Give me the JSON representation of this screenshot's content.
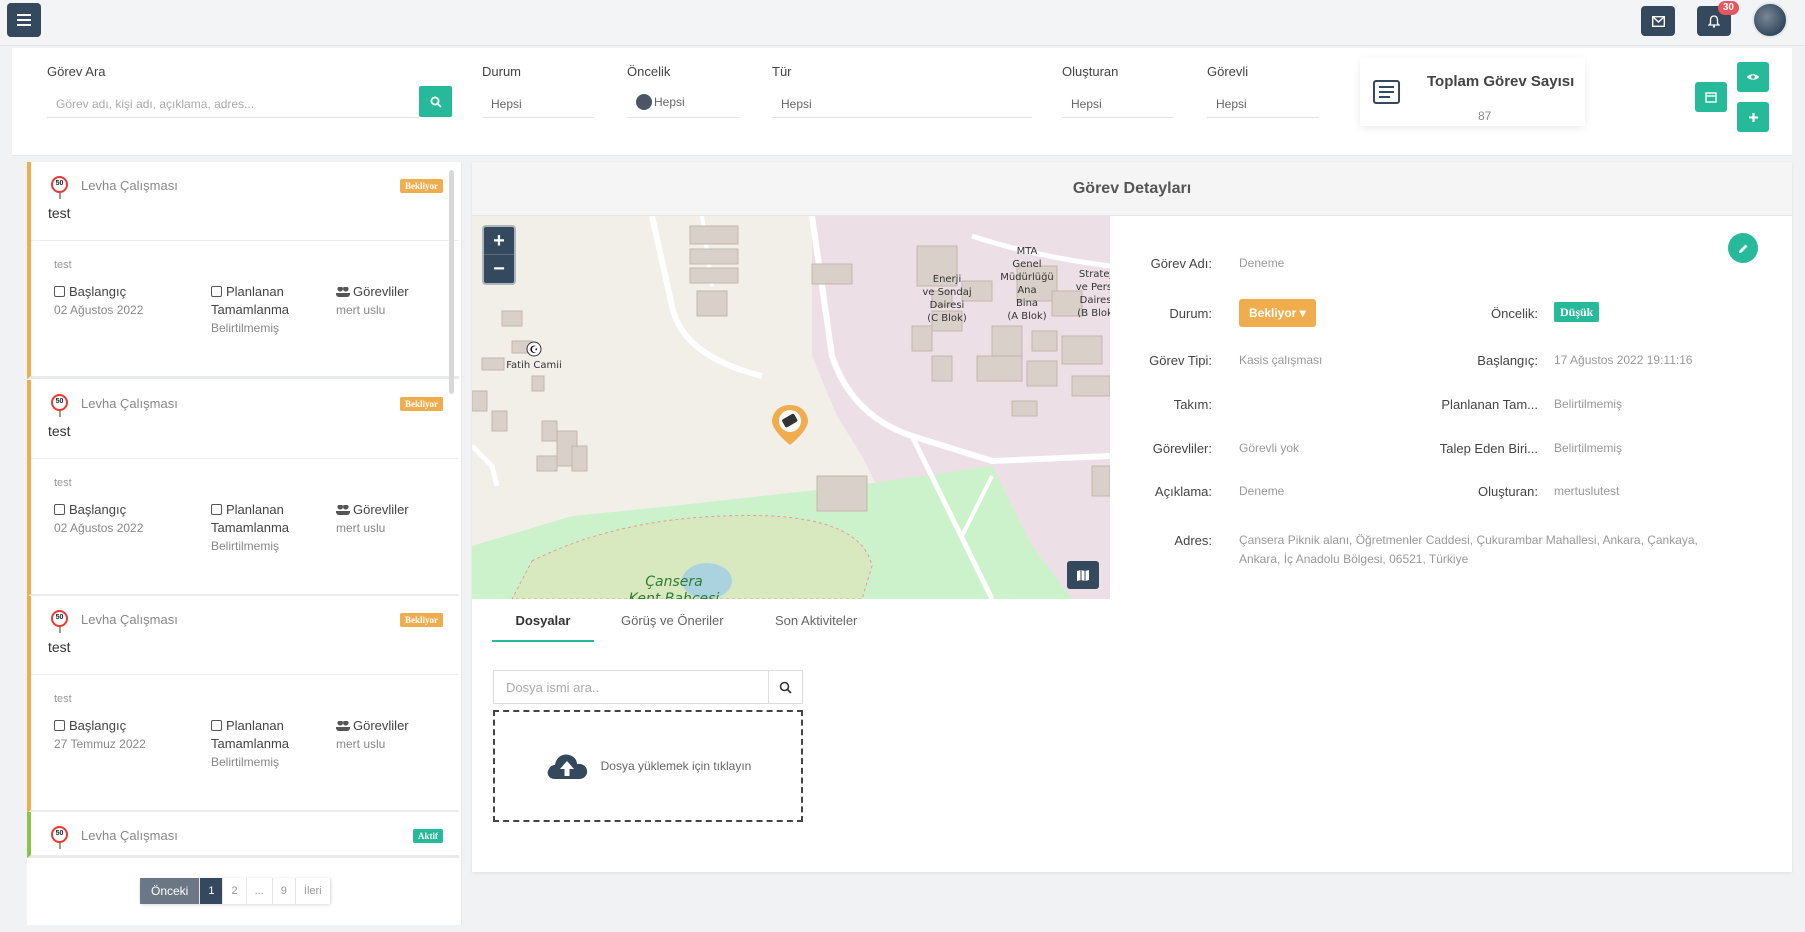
{
  "topbar": {
    "notification_count": "30"
  },
  "filters": {
    "search": {
      "label": "Görev Ara",
      "placeholder": "Görev adı, kişi adı, açıklama, adres..."
    },
    "status": {
      "label": "Durum",
      "value": "Hepsi"
    },
    "priority": {
      "label": "Öncelik",
      "value": "Hepsi"
    },
    "type": {
      "label": "Tür",
      "value": "Hepsi"
    },
    "creator": {
      "label": "Oluşturan",
      "value": "Hepsi"
    },
    "assignee": {
      "label": "Görevli",
      "value": "Hepsi"
    }
  },
  "total": {
    "title": "Toplam Görev Sayısı",
    "count": "87"
  },
  "tasks": [
    {
      "type": "Levha Çalışması",
      "title": "test",
      "badge": "Bekliyor",
      "desc": "test",
      "start_label": "Başlangıç",
      "start_date": "02 Ağustos 2022",
      "planned_label1": "Planlanan",
      "planned_label2": "Tamamlanma",
      "planned_value": "Belirtilmemiş",
      "assignees_label": "Görevliler",
      "assignees": "mert uslu"
    },
    {
      "type": "Levha Çalışması",
      "title": "test",
      "badge": "Bekliyor",
      "desc": "test",
      "start_label": "Başlangıç",
      "start_date": "02 Ağustos 2022",
      "planned_label1": "Planlanan",
      "planned_label2": "Tamamlanma",
      "planned_value": "Belirtilmemiş",
      "assignees_label": "Görevliler",
      "assignees": "mert uslu"
    },
    {
      "type": "Levha Çalışması",
      "title": "test",
      "badge": "Bekliyor",
      "desc": "test",
      "start_label": "Başlangıç",
      "start_date": "27 Temmuz 2022",
      "planned_label1": "Planlanan",
      "planned_label2": "Tamamlanma",
      "planned_value": "Belirtilmemiş",
      "assignees_label": "Görevliler",
      "assignees": "mert uslu"
    },
    {
      "type": "Levha Çalışması",
      "badge": "Aktif"
    }
  ],
  "sign_text": "50",
  "pagination": {
    "prev": "Önceki",
    "pages": [
      "1",
      "2",
      "...",
      "9"
    ],
    "next": "İleri"
  },
  "detail": {
    "header": "Görev Detayları",
    "map_labels": {
      "mosque": "Fatih Camii",
      "mta1": "MTA",
      "mta2": "Genel",
      "mta3": "Müdürlüğü",
      "mta4": "Ana",
      "mta5": "Bina",
      "mta6": "(A Blok)",
      "enerji1": "Enerji",
      "enerji2": "ve Sondaj",
      "enerji3": "Dairesi",
      "enerji4": "(C Blok)",
      "strat1": "Strateji",
      "strat2": "ve Perso",
      "strat3": "Dairesi",
      "strat4": "(B Blok)",
      "park1": "Çansera",
      "park2": "Kent Bahçesi"
    },
    "fields": {
      "name_label": "Görev Adı:",
      "name": "Deneme",
      "status_label": "Durum:",
      "status": "Bekliyor",
      "priority_label": "Öncelik:",
      "priority": "Düşük",
      "tasktype_label": "Görev Tipi:",
      "tasktype": "Kasis çalışması",
      "start_label": "Başlangıç:",
      "start": "17 Ağustos 2022 19:11:16",
      "team_label": "Takım:",
      "planned_label": "Planlanan Tam...",
      "planned": "Belirtilmemiş",
      "assignees_label": "Görevliler:",
      "assignees": "Görevli yok",
      "requester_label": "Talep Eden Biri...",
      "requester": "Belirtilmemiş",
      "desc_label": "Açıklama:",
      "desc": "Deneme",
      "creator_label": "Oluşturan:",
      "creator": "mertuslutest",
      "address_label": "Adres:",
      "address1": "Çansera Piknik alanı, Öğretmenler Caddesi, Çukurambar Mahallesi, Ankara, Çankaya,",
      "address2": "Ankara, İç Anadolu Bölgesi, 06521, Türkiye"
    },
    "tabs": [
      "Dosyalar",
      "Görüş ve Öneriler",
      "Son Aktiviteler"
    ],
    "file_search_placeholder": "Dosya ismi ara..",
    "upload_text": "Dosya yüklemek için tıklayın"
  }
}
